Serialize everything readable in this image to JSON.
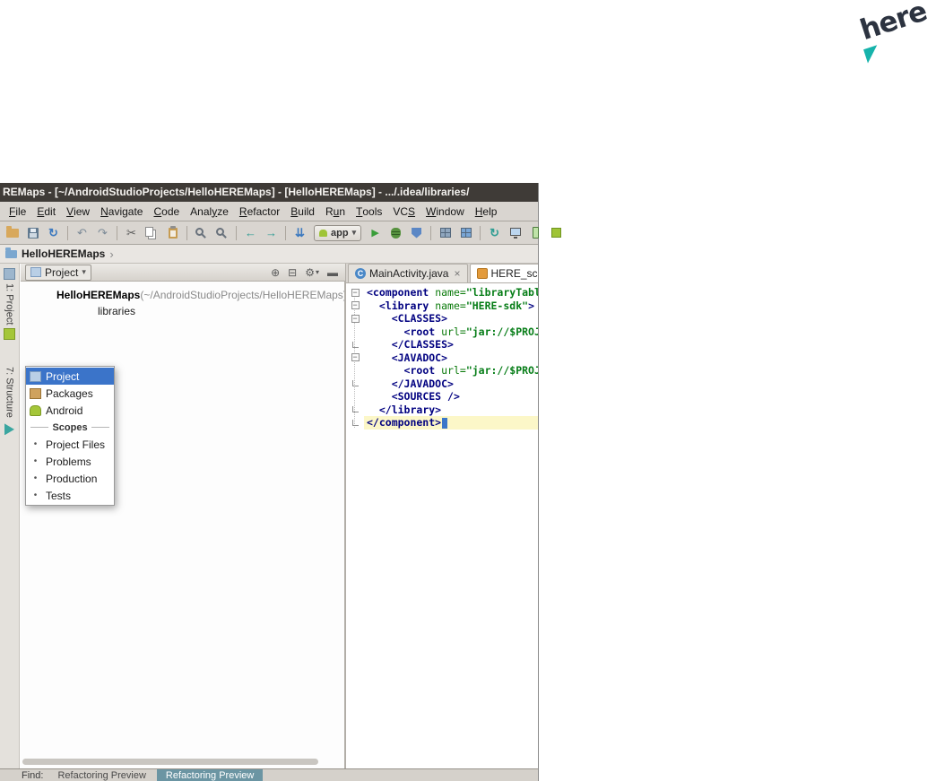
{
  "logo": {
    "text": "here"
  },
  "titlebar": {
    "title": "REMaps - [~/AndroidStudioProjects/HelloHEREMaps] - [HelloHEREMaps] - .../.idea/libraries/"
  },
  "menubar": {
    "items": [
      {
        "pre": "",
        "key": "F",
        "post": "ile"
      },
      {
        "pre": "",
        "key": "E",
        "post": "dit"
      },
      {
        "pre": "",
        "key": "V",
        "post": "iew"
      },
      {
        "pre": "",
        "key": "N",
        "post": "avigate"
      },
      {
        "pre": "",
        "key": "C",
        "post": "ode"
      },
      {
        "pre": "Anal",
        "key": "y",
        "post": "ze"
      },
      {
        "pre": "",
        "key": "R",
        "post": "efactor"
      },
      {
        "pre": "",
        "key": "B",
        "post": "uild"
      },
      {
        "pre": "R",
        "key": "u",
        "post": "n"
      },
      {
        "pre": "",
        "key": "T",
        "post": "ools"
      },
      {
        "pre": "VC",
        "key": "S",
        "post": ""
      },
      {
        "pre": "",
        "key": "W",
        "post": "indow"
      },
      {
        "pre": "",
        "key": "H",
        "post": "elp"
      }
    ]
  },
  "toolbar": {
    "run_config_label": "app"
  },
  "icons": {
    "sync": "↻",
    "undo": "↶",
    "redo": "↷",
    "cut": "✂",
    "back": "←",
    "forward": "→",
    "update": "⇊",
    "run": "▶",
    "dropdown_arrow": "▾",
    "gear": "⚙",
    "close": "×",
    "chevron": "›",
    "bullet": "•",
    "fold_open": "−",
    "panel_filter": "⊕",
    "panel_collapse": "⊟",
    "panel_hide": "▬",
    "class_letter": "C"
  },
  "navbar": {
    "crumb": "HelloHEREMaps"
  },
  "tool_stripe": {
    "project_label": "1: Project",
    "structure_label": "7: Structure"
  },
  "project_panel": {
    "view_selector": "Project",
    "tree": [
      {
        "name": "HelloHEREMaps",
        "path": " (~/AndroidStudioProjects/HelloHEREMaps)"
      },
      {
        "name": "libraries"
      }
    ]
  },
  "view_dropdown": {
    "items": [
      "Project",
      "Packages",
      "Android",
      "Scopes",
      "Project Files",
      "Problems",
      "Production",
      "Tests"
    ]
  },
  "editor": {
    "tabs": [
      {
        "label": "MainActivity.java"
      },
      {
        "label": "HERE_sc"
      }
    ],
    "code": [
      [
        "<component",
        " ",
        "name=",
        "\"libraryTable"
      ],
      [
        "  ",
        "<library",
        " ",
        "name=",
        "\"HERE-sdk\"",
        ">"
      ],
      [
        "    ",
        "<CLASSES>"
      ],
      [
        "      ",
        "<root",
        " ",
        "url=",
        "\"jar://$PROJE"
      ],
      [
        "    ",
        "</CLASSES>"
      ],
      [
        "    ",
        "<JAVADOC>"
      ],
      [
        "      ",
        "<root",
        " ",
        "url=",
        "\"jar://$PROJE"
      ],
      [
        "    ",
        "</JAVADOC>"
      ],
      [
        "    ",
        "<SOURCES />"
      ],
      [
        "  ",
        "</library>"
      ],
      [
        "</component>"
      ]
    ]
  },
  "bottom_bar": {
    "find_label": "Find:",
    "tabs": [
      "Refactoring Preview",
      "Refactoring Preview"
    ]
  }
}
